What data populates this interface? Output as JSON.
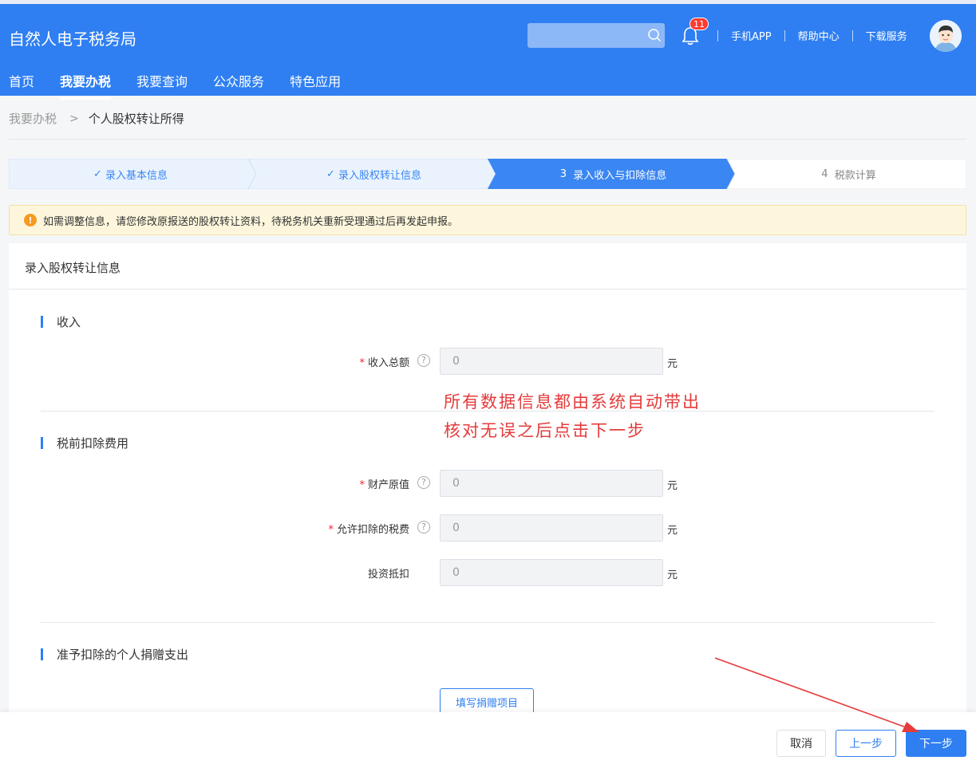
{
  "header": {
    "site_title": "自然人电子税务局",
    "search_placeholder": "",
    "notification_count": "11",
    "links": [
      "手机APP",
      "帮助中心",
      "下载服务"
    ]
  },
  "nav": {
    "items": [
      {
        "label": "首页",
        "active": false
      },
      {
        "label": "我要办税",
        "active": true
      },
      {
        "label": "我要查询",
        "active": false
      },
      {
        "label": "公众服务",
        "active": false
      },
      {
        "label": "特色应用",
        "active": false
      }
    ]
  },
  "breadcrumb": {
    "parent": "我要办税",
    "current": "个人股权转让所得"
  },
  "steps": [
    {
      "label": "录入基本信息",
      "status": "done",
      "number": ""
    },
    {
      "label": "录入股权转让信息",
      "status": "done",
      "number": ""
    },
    {
      "label": "录入收入与扣除信息",
      "status": "active",
      "number": "3"
    },
    {
      "label": "税款计算",
      "status": "pending",
      "number": "4"
    }
  ],
  "notice": {
    "icon": "warning-icon",
    "text": "如需调整信息，请您修改原报送的股权转让资料，待税务机关重新受理通过后再发起申报。"
  },
  "panel": {
    "title": "录入股权转让信息",
    "sections": {
      "income": {
        "title": "收入",
        "fields": [
          {
            "label": "收入总额",
            "required": true,
            "help": true,
            "value": "0",
            "unit": "元"
          }
        ]
      },
      "deduction": {
        "title": "税前扣除费用",
        "fields": [
          {
            "label": "财产原值",
            "required": true,
            "help": true,
            "value": "0",
            "unit": "元"
          },
          {
            "label": "允许扣除的税费",
            "required": true,
            "help": true,
            "value": "0",
            "unit": "元"
          },
          {
            "label": "投资抵扣",
            "required": false,
            "help": false,
            "value": "0",
            "unit": "元"
          }
        ]
      },
      "donation": {
        "title": "准予扣除的个人捐赠支出",
        "button_label": "填写捐赠项目"
      }
    }
  },
  "annotation": {
    "line1": "所有数据信息都由系统自动带出",
    "line2": "核对无误之后点击下一步",
    "color": "#e53b3b"
  },
  "footer": {
    "cancel_label": "取消",
    "prev_label": "上一步",
    "next_label": "下一步"
  },
  "colors": {
    "primary": "#2f7ff2",
    "required": "#f5222d",
    "warning": "#f59a23"
  }
}
